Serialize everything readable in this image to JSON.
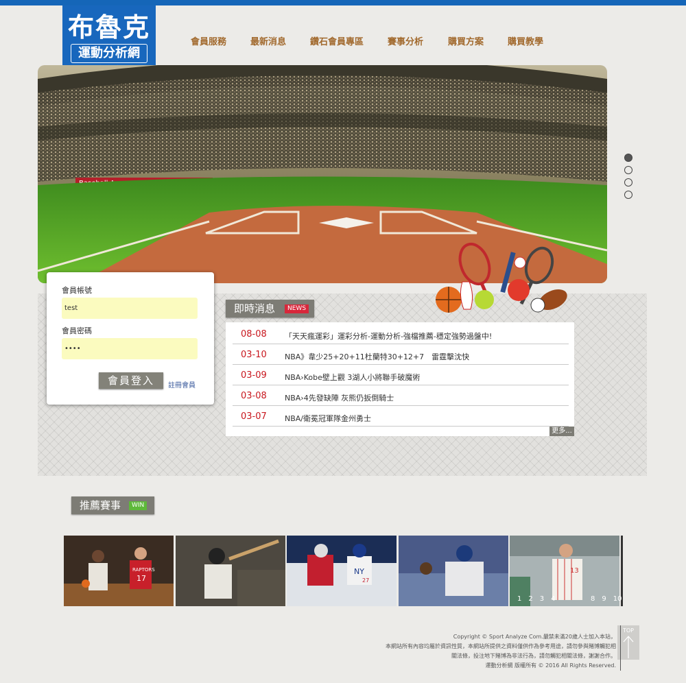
{
  "logo": {
    "main": "布魯克",
    "sub": "運動分析網",
    "stars": "★ ★ ★"
  },
  "nav": [
    "會員服務",
    "最新消息",
    "鑽石會員專區",
    "賽事分析",
    "購買方案",
    "購買教學"
  ],
  "hero": {
    "stadium_sign": "Baseball Arena",
    "slides": 4,
    "active_slide": 1
  },
  "login": {
    "account_label": "會員帳號",
    "account_value": "test",
    "password_label": "會員密碼",
    "password_value": "••••",
    "login_button": "會員登入",
    "register_link": "註冊會員"
  },
  "news": {
    "title": "即時消息",
    "badge": "NEWS",
    "items": [
      {
        "date": "08-08",
        "text": "「天天瘋運彩」運彩分析-運動分析-強檔推薦-穩定強勢過盤中!"
      },
      {
        "date": "03-10",
        "text": "NBA》韋少25+20+11杜蘭特30+12+7　雷霆擊沈快"
      },
      {
        "date": "03-09",
        "text": "NBA›Kobe壁上觀 3湖人小將聯手破魔術"
      },
      {
        "date": "03-08",
        "text": "NBA›4先發缺陣 灰熊仍扳倒騎士"
      },
      {
        "date": "03-07",
        "text": "NBA/衛冕冠軍隊金州勇士"
      }
    ],
    "more": "更多..."
  },
  "recommend": {
    "title": "推薦賽事",
    "badge": "WIN",
    "pager_left": "1　2　3　4",
    "pager_right": "8　9　10",
    "photo_texts": [
      "RAPTORS",
      "17",
      "NY",
      "27",
      "13"
    ]
  },
  "footer": {
    "lines": [
      "Copyright © Sport Analyze Com.嚴禁未滿20歲人士加入本站，",
      "本網站所有內容均屬於資訊性質，本網站所提供之資料僅供作為參考用途，請勿參與賭博觸犯相",
      "關法條，投注地下賭博為非法行為，請勿觸犯相關法條，謝謝合作。",
      "運動分析網 版權所有 © 2016 All Rights Reserved."
    ],
    "top": "TOP"
  },
  "colors": {
    "brand_blue": "#1867bd",
    "nav_text": "#a26a2e",
    "date_red": "#c8161d",
    "input_yellow": "#fbfbbf"
  }
}
